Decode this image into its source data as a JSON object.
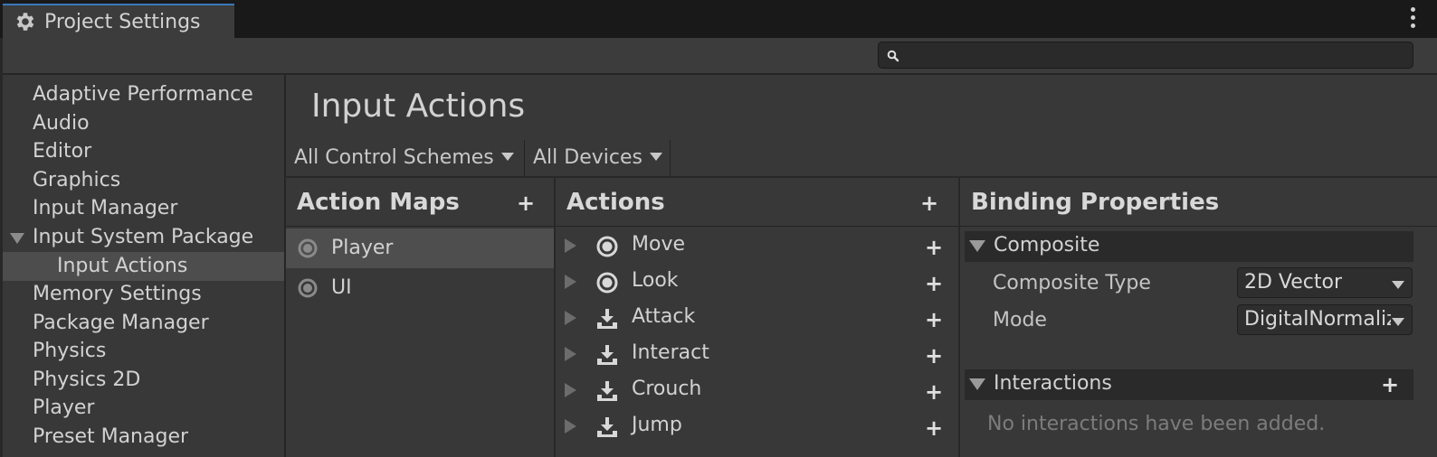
{
  "window": {
    "tab_title": "Project Settings",
    "menu_icon": "kebab-menu-icon"
  },
  "search": {
    "placeholder": "",
    "icon": "search-icon"
  },
  "sidebar": {
    "items": [
      {
        "label": "Adaptive Performance"
      },
      {
        "label": "Audio"
      },
      {
        "label": "Editor"
      },
      {
        "label": "Graphics"
      },
      {
        "label": "Input Manager"
      },
      {
        "label": "Input System Package",
        "expanded": true
      },
      {
        "label": "Input Actions",
        "selected": true
      },
      {
        "label": "Memory Settings"
      },
      {
        "label": "Package Manager"
      },
      {
        "label": "Physics"
      },
      {
        "label": "Physics 2D"
      },
      {
        "label": "Player"
      },
      {
        "label": "Preset Manager"
      }
    ]
  },
  "main": {
    "title": "Input Actions",
    "control_schemes_label": "All Control Schemes",
    "devices_label": "All Devices"
  },
  "action_maps": {
    "title": "Action Maps",
    "add_label": "+",
    "items": [
      {
        "label": "Player",
        "selected": true
      },
      {
        "label": "UI"
      }
    ]
  },
  "actions": {
    "title": "Actions",
    "add_label": "+",
    "items": [
      {
        "label": "Move",
        "icon": "value-action-icon",
        "add_label": "+"
      },
      {
        "label": "Look",
        "icon": "value-action-icon",
        "add_label": "+"
      },
      {
        "label": "Attack",
        "icon": "button-action-icon",
        "add_label": "+"
      },
      {
        "label": "Interact",
        "icon": "button-action-icon",
        "add_label": "+"
      },
      {
        "label": "Crouch",
        "icon": "button-action-icon",
        "add_label": "+"
      },
      {
        "label": "Jump",
        "icon": "button-action-icon",
        "add_label": "+"
      }
    ]
  },
  "binding_properties": {
    "title": "Binding Properties",
    "composite": {
      "header": "Composite",
      "type_label": "Composite Type",
      "type_value": "2D Vector",
      "mode_label": "Mode",
      "mode_value": "DigitalNormalized"
    },
    "interactions": {
      "header": "Interactions",
      "add_label": "+",
      "empty_text": "No interactions have been added."
    }
  },
  "colors": {
    "accent": "#3a79bb",
    "panel": "#383838",
    "background": "#282828"
  }
}
